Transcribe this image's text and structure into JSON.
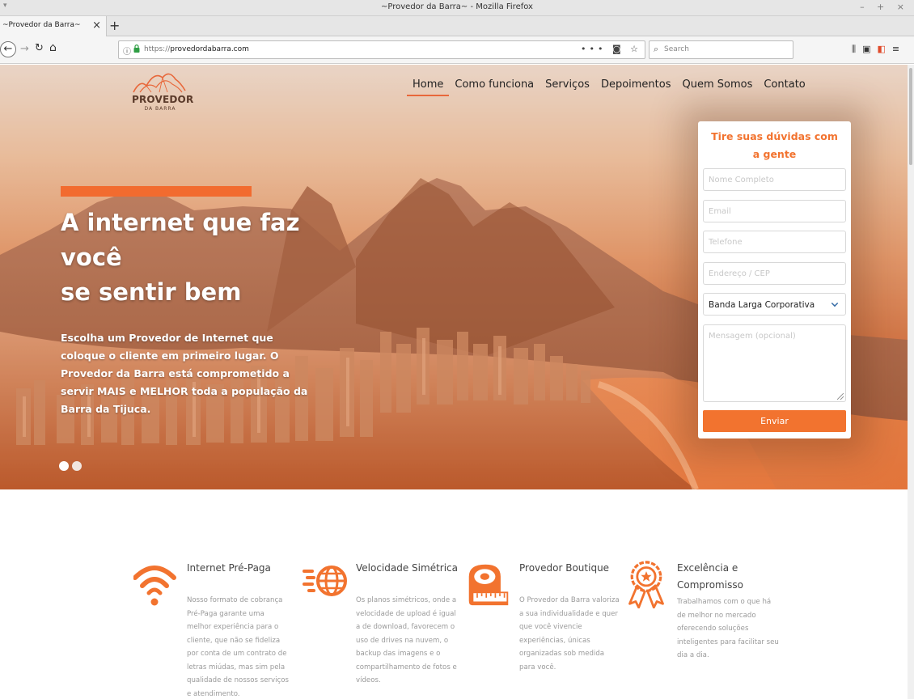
{
  "window": {
    "title": "~Provedor da Barra~ - Mozilla Firefox",
    "controls": "– + ×"
  },
  "tab": {
    "label": "~Provedor da Barra~",
    "close": "×",
    "new": "+"
  },
  "toolbar": {
    "url_protocol": "https://",
    "url_host": "provedordabarra.com",
    "page_actions": "••• ◙ ☆",
    "search_placeholder": "Search"
  },
  "site": {
    "logo_main": "PROVEDOR",
    "logo_sub": "DA BARRA",
    "nav": [
      {
        "label": "Home",
        "active": true
      },
      {
        "label": "Como funciona"
      },
      {
        "label": "Serviços"
      },
      {
        "label": "Depoimentos"
      },
      {
        "label": "Quem Somos"
      },
      {
        "label": "Contato"
      }
    ],
    "hero": {
      "headline_1": "A internet que faz",
      "headline_2": "você",
      "headline_3": "se sentir bem",
      "subtext": "Escolha um Provedor de Internet que coloque o cliente em primeiro lugar. O Provedor da Barra está comprometido a servir MAIS e MELHOR toda a população da Barra da Tijuca.",
      "slides": 2,
      "active_slide": 1
    },
    "form": {
      "title": "Tire suas dúvidas com a gente",
      "name_placeholder": "Nome Completo",
      "email_placeholder": "Email",
      "phone_placeholder": "Telefone",
      "address_placeholder": "Endereço / CEP",
      "plan_selected": "Banda Larga Corporativa",
      "message_placeholder": "Mensagem (opcional)",
      "submit": "Enviar"
    },
    "features": [
      {
        "icon": "wifi-icon",
        "title": "Internet Pré-Paga",
        "description": "Nosso formato de cobrança Pré-Paga garante uma melhor experiência para o cliente, que não se fideliza por conta de um contrato de letras miúdas, mas sim pela qualidade de nossos serviços e atendimento."
      },
      {
        "icon": "fast-globe-icon",
        "title": "Velocidade Simétrica",
        "description": "Os planos simétricos, onde a velocidade de upload é igual a de download, favorecem o uso de drives na nuvem, o backup das imagens e o compartilhamento de fotos e vídeos."
      },
      {
        "icon": "measuring-tape-icon",
        "title": "Provedor Boutique",
        "description": "O Provedor da Barra valoriza a sua individualidade e quer que você vivencie experiências, únicas organizadas sob medida para você."
      },
      {
        "icon": "award-ribbon-icon",
        "title": "Excelência e Compromisso",
        "description": "Trabalhamos com o que há de melhor no mercado oferecendo soluções inteligentes para facilitar seu dia a dia."
      }
    ],
    "accent_color": "#f2732f"
  }
}
